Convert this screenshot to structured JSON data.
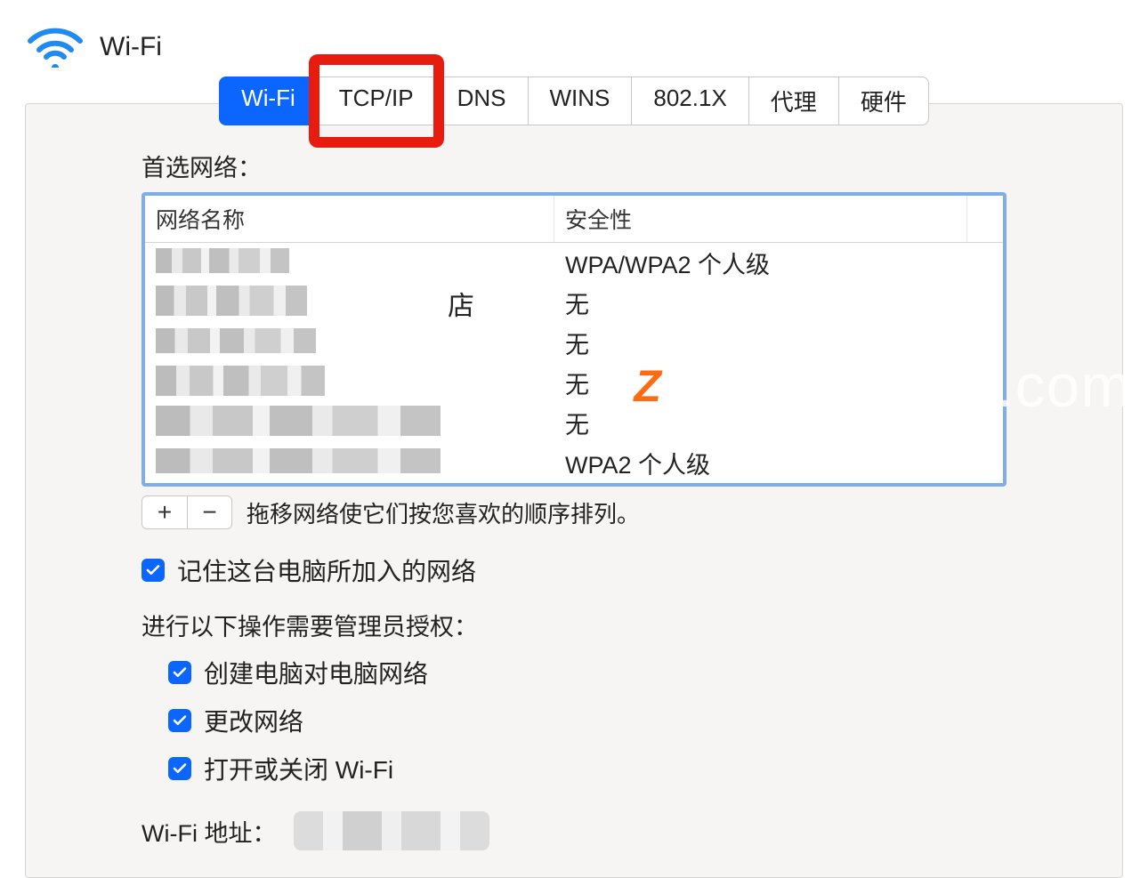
{
  "header": {
    "title": "Wi-Fi",
    "icon": "wifi-icon"
  },
  "tabs": [
    {
      "label": "Wi-Fi",
      "active": true,
      "highlight": false
    },
    {
      "label": "TCP/IP",
      "active": false,
      "highlight": true
    },
    {
      "label": "DNS",
      "active": false,
      "highlight": false
    },
    {
      "label": "WINS",
      "active": false,
      "highlight": false
    },
    {
      "label": "802.1X",
      "active": false,
      "highlight": false
    },
    {
      "label": "代理",
      "active": false,
      "highlight": false
    },
    {
      "label": "硬件",
      "active": false,
      "highlight": false
    }
  ],
  "preferred_networks": {
    "section_label": "首选网络：",
    "columns": {
      "name": "网络名称",
      "security": "安全性"
    },
    "rows": [
      {
        "name_redacted": true,
        "name_suffix": "",
        "security": "WPA/WPA2 个人级"
      },
      {
        "name_redacted": true,
        "name_suffix": "店",
        "security": "无"
      },
      {
        "name_redacted": true,
        "name_suffix": "",
        "security": "无"
      },
      {
        "name_redacted": true,
        "name_suffix": "",
        "security": "无"
      },
      {
        "name_redacted": true,
        "name_suffix": "",
        "security": "无"
      },
      {
        "name_redacted": true,
        "name_suffix": "",
        "security": "WPA2 个人级"
      }
    ],
    "buttons": {
      "add": "+",
      "remove": "−"
    },
    "hint": "拖移网络使它们按您喜欢的顺序排列。"
  },
  "options": {
    "remember_networks": {
      "label": "记住这台电脑所加入的网络",
      "checked": true
    },
    "admin_required_label": "进行以下操作需要管理员授权：",
    "create_adhoc": {
      "label": "创建电脑对电脑网络",
      "checked": true
    },
    "change_network": {
      "label": "更改网络",
      "checked": true
    },
    "toggle_wifi": {
      "label": "打开或关闭 Wi-Fi",
      "checked": true
    }
  },
  "wifi_address": {
    "label": "Wi-Fi 地址：",
    "value_redacted": true
  },
  "watermark": {
    "logo_letter": "Z",
    "text": "www.MacZ.com"
  },
  "colors": {
    "accent": "#0a66ff",
    "highlight_border": "#e81b0f",
    "table_focus": "#7daee8"
  }
}
